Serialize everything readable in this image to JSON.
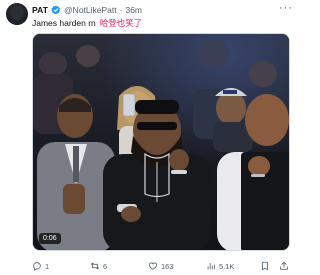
{
  "author": {
    "display_name": "PAT",
    "handle": "@NotLikePatt",
    "separator": "·",
    "time_ago": "36m"
  },
  "tweet": {
    "text": "James harden rn",
    "text_secondary": "哈登也笑了"
  },
  "media": {
    "duration": "0:06"
  },
  "actions": {
    "replies": "1",
    "retweets": "6",
    "likes": "163",
    "views": "5.1K"
  },
  "icons": [
    "verified-badge-icon",
    "more-icon",
    "reply-icon",
    "retweet-icon",
    "like-icon",
    "views-icon",
    "bookmark-icon",
    "share-icon"
  ],
  "colors": {
    "accent_blue": "#1d9bf0",
    "secondary_text": "#536471",
    "highlight_red": "#e0245e"
  }
}
